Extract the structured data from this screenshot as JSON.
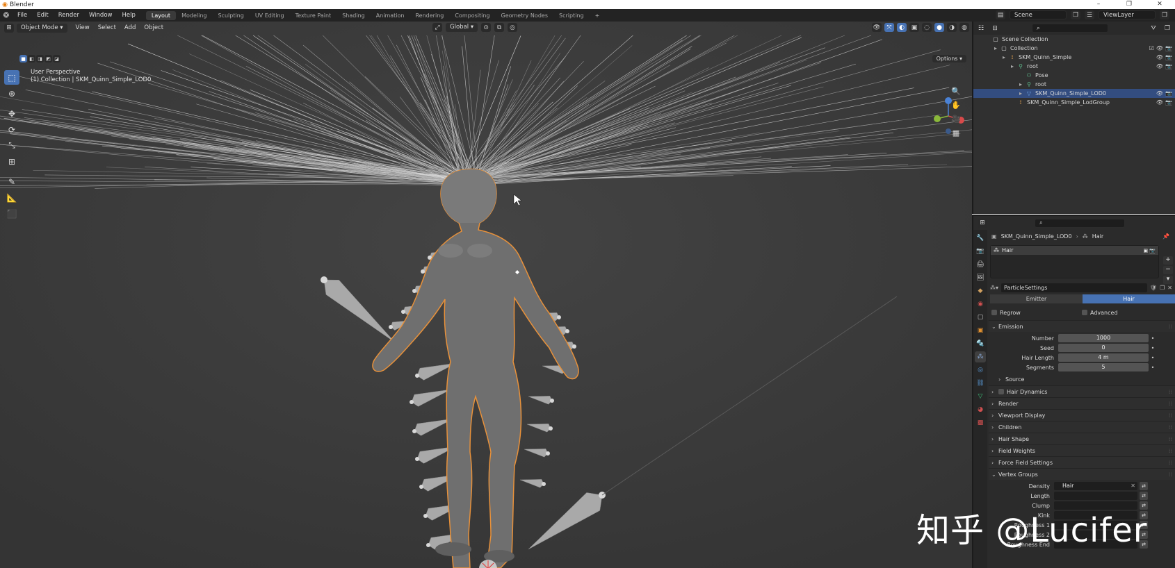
{
  "window": {
    "title": "Blender",
    "controls": [
      "–",
      "❐",
      "✕"
    ]
  },
  "menu": [
    "File",
    "Edit",
    "Render",
    "Window",
    "Help"
  ],
  "workspaces": [
    "Layout",
    "Modeling",
    "Sculpting",
    "UV Editing",
    "Texture Paint",
    "Shading",
    "Animation",
    "Rendering",
    "Compositing",
    "Geometry Nodes",
    "Scripting"
  ],
  "active_workspace": "Layout",
  "scene": {
    "scene_name": "Scene",
    "view_layer": "ViewLayer"
  },
  "viewport": {
    "mode": "Object Mode",
    "menus": [
      "View",
      "Select",
      "Add",
      "Object"
    ],
    "orientation": "Global",
    "options_label": "Options",
    "info_line1": "User Perspective",
    "info_line2": "(1) Collection | SKM_Quinn_Simple_LOD0"
  },
  "outliner": {
    "rows": [
      {
        "label": "Scene Collection",
        "indent": 0,
        "icon": "collection",
        "selected": false
      },
      {
        "label": "Collection",
        "indent": 1,
        "icon": "collection",
        "selected": false
      },
      {
        "label": "SKM_Quinn_Simple",
        "indent": 2,
        "icon": "armature",
        "selected": false
      },
      {
        "label": "root",
        "indent": 3,
        "icon": "bone",
        "selected": false
      },
      {
        "label": "Pose",
        "indent": 4,
        "icon": "pose",
        "selected": false
      },
      {
        "label": "root",
        "indent": 4,
        "icon": "bone",
        "selected": false
      },
      {
        "label": "SKM_Quinn_Simple_LOD0",
        "indent": 4,
        "icon": "mesh",
        "selected": true
      },
      {
        "label": "SKM_Quinn_Simple_LodGroup",
        "indent": 3,
        "icon": "empty",
        "selected": false
      }
    ]
  },
  "properties": {
    "breadcrumb_object": "SKM_Quinn_Simple_LOD0",
    "breadcrumb_system": "Hair",
    "particle_system_name": "Hair",
    "settings_name": "ParticleSettings",
    "type_options": [
      "Emitter",
      "Hair"
    ],
    "type_selected": "Hair",
    "regrow_label": "Regrow",
    "advanced_label": "Advanced",
    "emission_label": "Emission",
    "emission_fields": [
      {
        "label": "Number",
        "value": "1000"
      },
      {
        "label": "Seed",
        "value": "0"
      },
      {
        "label": "Hair Length",
        "value": "4 m"
      },
      {
        "label": "Segments",
        "value": "5"
      }
    ],
    "source_label": "Source",
    "panels": [
      "Hair Dynamics",
      "Render",
      "Viewport Display",
      "Children",
      "Hair Shape",
      "Field Weights",
      "Force Field Settings"
    ],
    "vertex_groups_label": "Vertex Groups",
    "vertex_groups": [
      {
        "label": "Density",
        "value": "Hair"
      },
      {
        "label": "Length",
        "value": ""
      },
      {
        "label": "Clump",
        "value": ""
      },
      {
        "label": "Kink",
        "value": ""
      },
      {
        "label": "Roughness 1",
        "value": ""
      },
      {
        "label": "Roughness 2",
        "value": ""
      },
      {
        "label": "Roughness End",
        "value": ""
      }
    ]
  },
  "watermark": "知乎 @Lucifer",
  "colors": {
    "accent": "#4772b3",
    "selected_row": "#334d80",
    "selection_outline": "#e8913a",
    "viewport_bg": "#3d3d3d"
  }
}
